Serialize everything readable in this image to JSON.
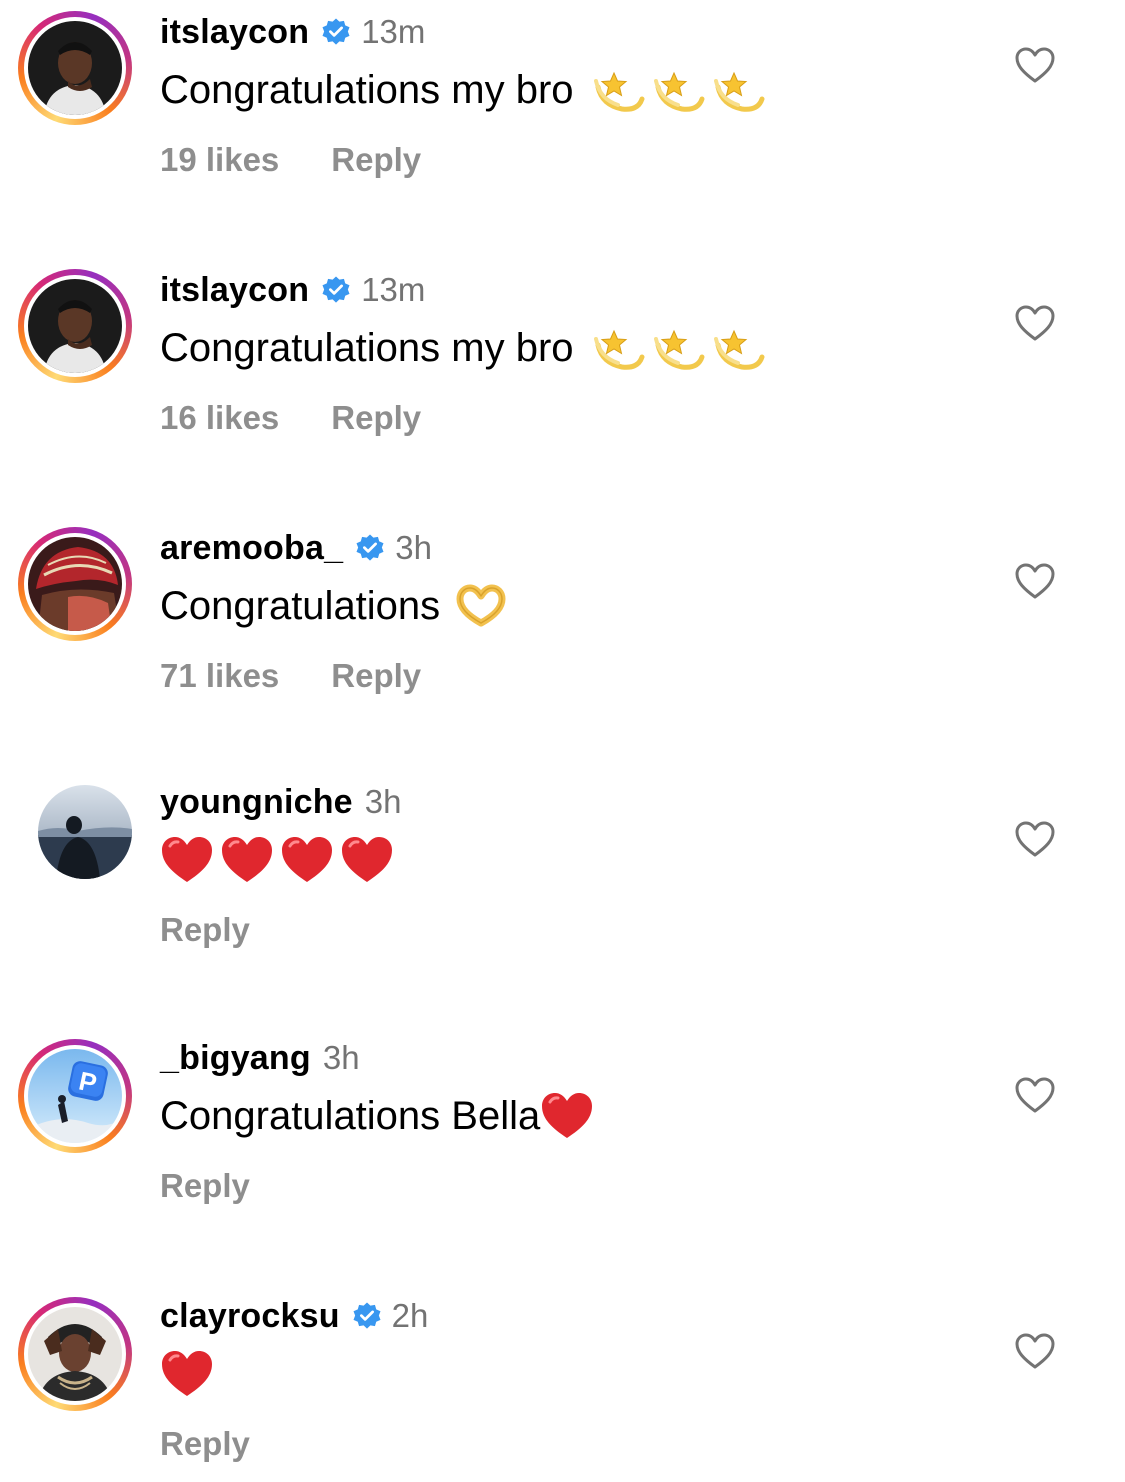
{
  "comments": [
    {
      "username": "itslaycon",
      "verified": true,
      "time": "13m",
      "text": "Congratulations my bro",
      "emoji": [
        "dizzy-star",
        "dizzy-star",
        "dizzy-star"
      ],
      "likes": "19 likes",
      "reply": "Reply",
      "avatar_ring": "story"
    },
    {
      "username": "itslaycon",
      "verified": true,
      "time": "13m",
      "text": "Congratulations my bro",
      "emoji": [
        "dizzy-star",
        "dizzy-star",
        "dizzy-star"
      ],
      "likes": "16 likes",
      "reply": "Reply",
      "avatar_ring": "story"
    },
    {
      "username": "aremooba_",
      "verified": true,
      "time": "3h",
      "text": "Congratulations",
      "emoji": [
        "heart-hands"
      ],
      "likes": "71 likes",
      "reply": "Reply",
      "avatar_ring": "story"
    },
    {
      "username": "youngniche",
      "verified": false,
      "time": "3h",
      "text": "",
      "emoji": [
        "red-heart",
        "red-heart",
        "red-heart",
        "red-heart"
      ],
      "likes": "",
      "reply": "Reply",
      "avatar_ring": "none"
    },
    {
      "username": "_bigyang",
      "verified": false,
      "time": "3h",
      "text": "Congratulations Bella",
      "emoji": [
        "red-heart"
      ],
      "likes": "",
      "reply": "Reply",
      "avatar_ring": "story"
    },
    {
      "username": "clayrocksu",
      "verified": true,
      "time": "2h",
      "text": "",
      "emoji": [
        "red-heart"
      ],
      "likes": "",
      "reply": "Reply",
      "avatar_ring": "story"
    }
  ],
  "colors": {
    "verified_badge": "#3897f0",
    "secondary_text": "#737373",
    "meta_text": "#8e8e8e",
    "heart": "#e0272e"
  },
  "icons": {
    "like": "heart-outline-icon",
    "verified": "verified-badge-icon"
  }
}
